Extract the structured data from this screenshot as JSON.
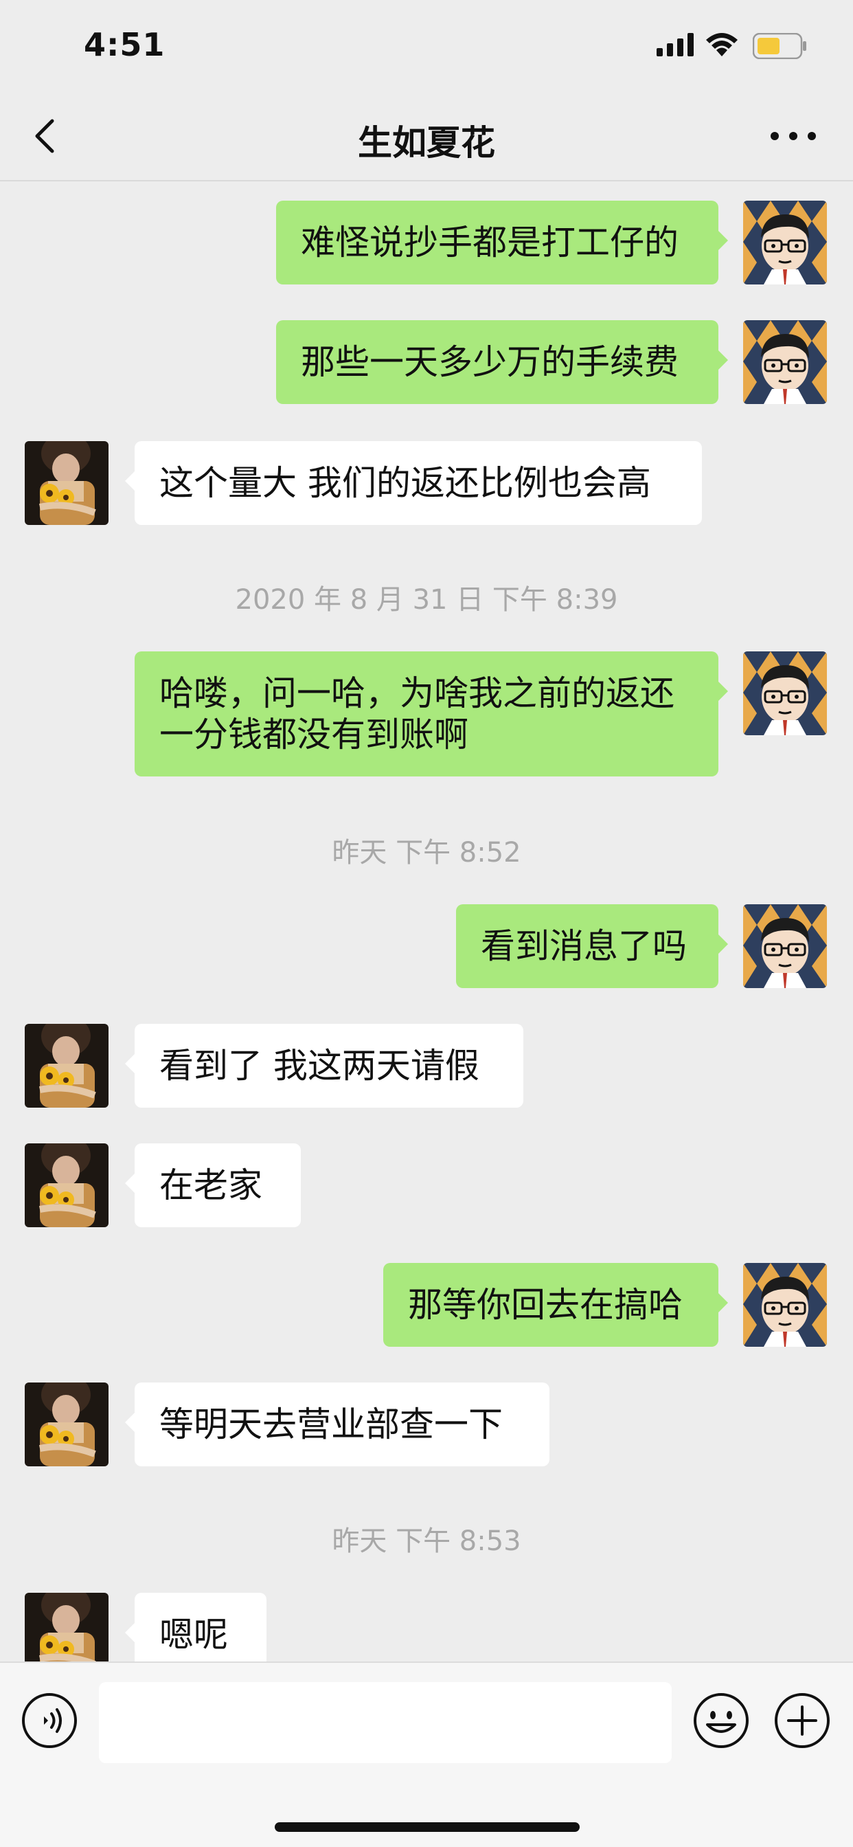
{
  "status_bar": {
    "time": "4:51"
  },
  "header": {
    "title": "生如夏花"
  },
  "messages": [
    {
      "text": "难怪说抄手都是打工仔的"
    },
    {
      "text": "那些一天多少万的手续费"
    },
    {
      "text": "这个量大 我们的返还比例也会高"
    },
    {
      "text": "2020 年 8 月 31 日 下午 8:39"
    },
    {
      "text": "哈喽，问一哈，为啥我之前的返还一分钱都没有到账啊"
    },
    {
      "text": "昨天 下午 8:52"
    },
    {
      "text": "看到消息了吗"
    },
    {
      "text": "看到了 我这两天请假"
    },
    {
      "text": "在老家"
    },
    {
      "text": "那等你回去在搞哈"
    },
    {
      "text": "等明天去营业部查一下"
    },
    {
      "text": "昨天 下午 8:53"
    },
    {
      "text": "嗯呢"
    }
  ],
  "input": {
    "value": ""
  },
  "icons": {
    "back": "chevron-left-icon",
    "more": "more-dots-icon",
    "signal": "cellular-signal-icon",
    "wifi": "wifi-icon",
    "battery": "battery-icon",
    "voice": "voice-icon",
    "emoji": "emoji-icon",
    "add": "plus-circle-icon"
  },
  "colors": {
    "background": "#ededed",
    "sent_bubble": "#a9e97d",
    "received_bubble": "#ffffff",
    "timestamp_text": "#a8a8a8",
    "battery_fill": "#f5c93b"
  }
}
